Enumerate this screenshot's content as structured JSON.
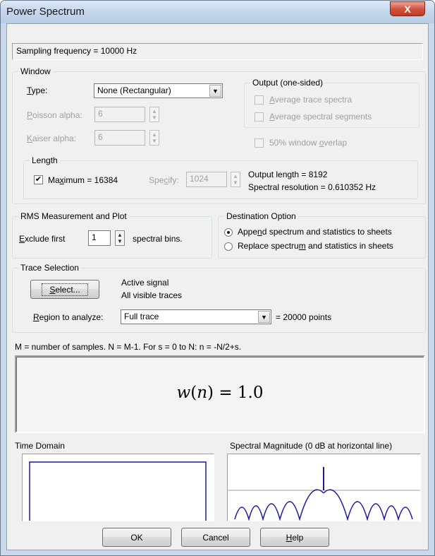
{
  "window": {
    "title": "Power Spectrum",
    "close_glyph": "X"
  },
  "sampling_text": "Sampling frequency = 10000 Hz",
  "window_group": {
    "label": "Window",
    "type_label_pre": "",
    "type_label_u": "T",
    "type_label_post": "ype:",
    "type_value": "None (Rectangular)",
    "poisson_label_u": "P",
    "poisson_label_post": "oisson alpha:",
    "poisson_value": "6",
    "kaiser_label_u": "K",
    "kaiser_label_post": "aiser alpha:",
    "kaiser_value": "6"
  },
  "output_group": {
    "label": "Output (one-sided)",
    "avg_trace_u": "A",
    "avg_trace_post": "verage trace spectra",
    "avg_seg_u": "A",
    "avg_seg_post": "verage spectral segments",
    "overlap_pre": "50% window ",
    "overlap_u": "o",
    "overlap_post": "verlap"
  },
  "length_group": {
    "label": "Length",
    "maximum_pre": "Ma",
    "maximum_u": "x",
    "maximum_post": "imum = 16384",
    "maximum_checked": "✔",
    "specify_pre": "Spe",
    "specify_u": "c",
    "specify_post": "ify:",
    "specify_value": "1024",
    "output_length": "Output length = 8192",
    "spectral_resolution": "Spectral resolution = 0.610352 Hz"
  },
  "rms_group": {
    "label": "RMS Measurement and Plot",
    "exclude_u": "E",
    "exclude_post": "xclude first",
    "exclude_value": "1",
    "bins_label": "spectral bins."
  },
  "destination_group": {
    "label": "Destination Option",
    "append_pre": "Appe",
    "append_u": "n",
    "append_post": "d spectrum and statistics to sheets",
    "replace_pre": "Replace spectru",
    "replace_u": "m",
    "replace_post": " and statistics in sheets"
  },
  "trace_group": {
    "label": "Trace Selection",
    "select_u": "S",
    "select_post": "elect...",
    "active_signal": "Active signal",
    "visible_traces": "All visible traces",
    "region_u": "R",
    "region_post": "egion to analyze:",
    "region_value": "Full trace",
    "points": "= 20000 points"
  },
  "formula_note": "M = number of samples.  N = M-1.  For s = 0 to N: n = -N/2+s.",
  "formula": {
    "lhs": "w",
    "var": "n",
    "rhs": "= 1.0"
  },
  "time_domain_label": "Time Domain",
  "spectral_label": "Spectral Magnitude (0 dB at horizontal line)",
  "buttons": {
    "ok": "OK",
    "cancel": "Cancel",
    "help_u": "H",
    "help_post": "elp"
  },
  "colors": {
    "plot_line": "#1a1aa6",
    "reference_line": "#a0a0a0"
  }
}
